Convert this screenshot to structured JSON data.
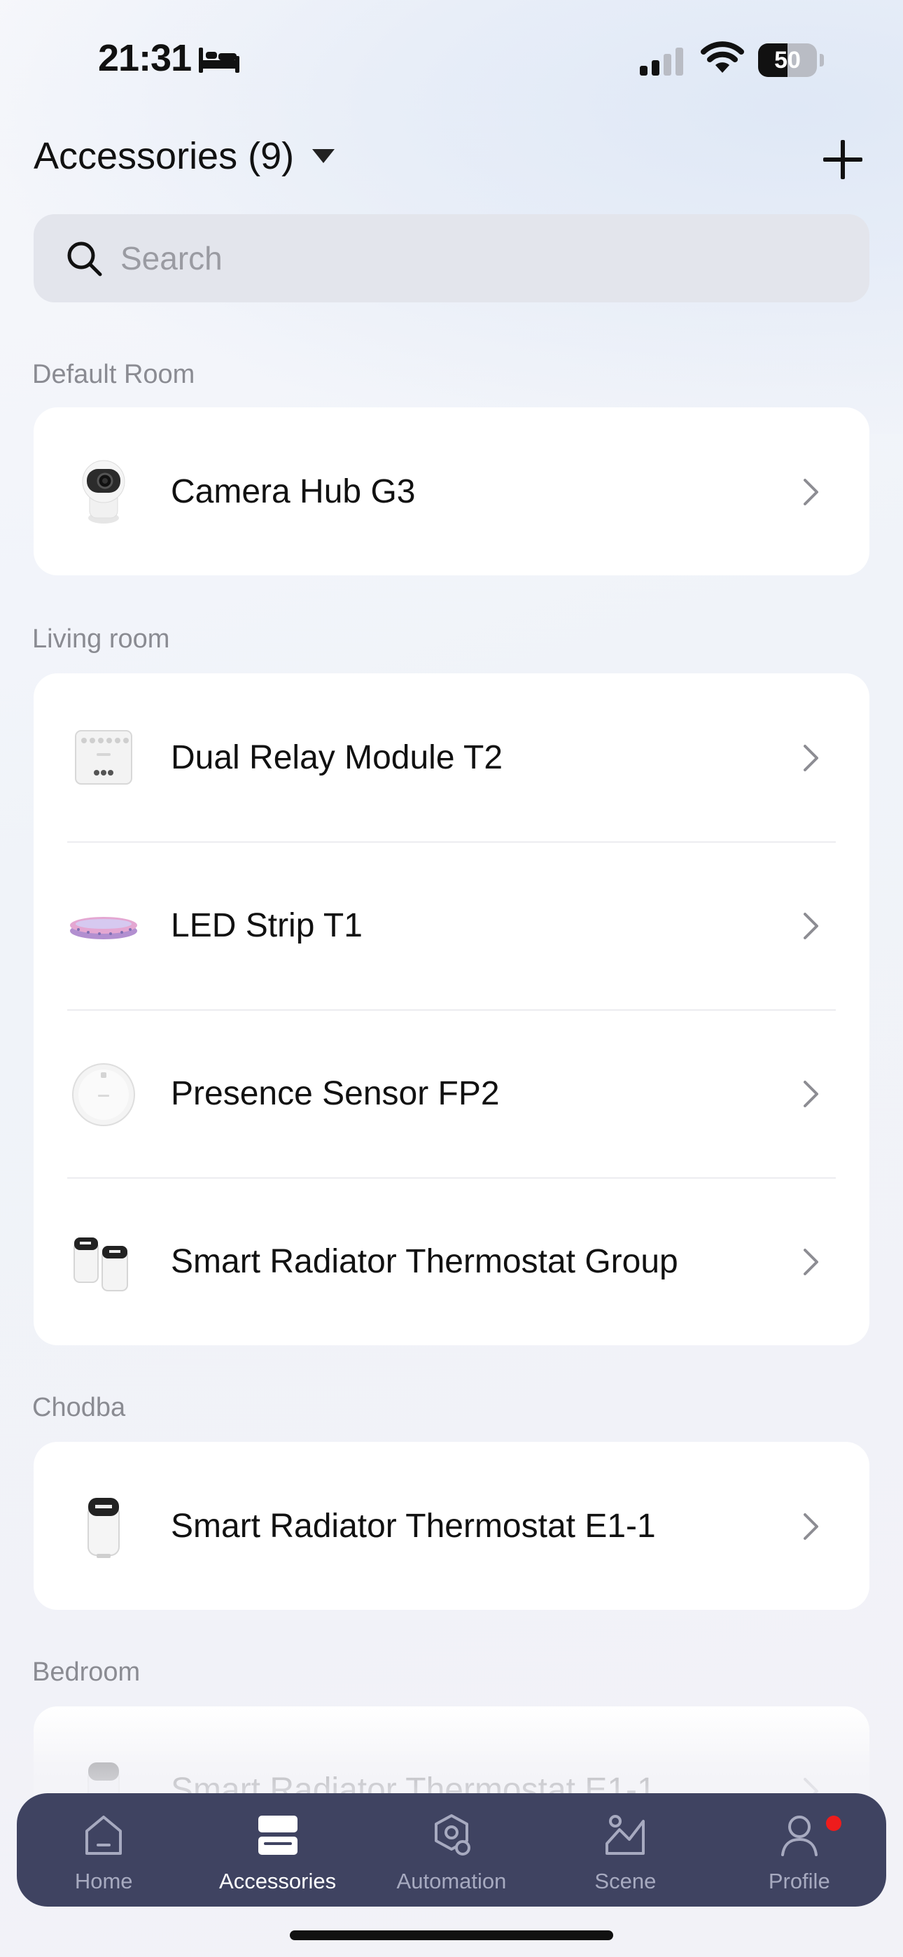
{
  "status_bar": {
    "time": "21:31",
    "focus_icon": "bed-icon",
    "battery_percent": 50,
    "battery_text": "50"
  },
  "header": {
    "title": "Accessories (9)",
    "add_icon": "plus-icon"
  },
  "search": {
    "placeholder": "Search"
  },
  "rooms": [
    {
      "name": "Default Room",
      "items": [
        {
          "label": "Camera Hub G3",
          "icon": "camera-hub-icon"
        }
      ]
    },
    {
      "name": "Living room",
      "items": [
        {
          "label": "Dual Relay Module T2",
          "icon": "relay-module-icon"
        },
        {
          "label": "LED Strip T1",
          "icon": "led-strip-icon"
        },
        {
          "label": "Presence Sensor FP2",
          "icon": "presence-sensor-icon"
        },
        {
          "label": "Smart Radiator Thermostat Group",
          "icon": "thermostat-group-icon"
        }
      ]
    },
    {
      "name": "Chodba",
      "items": [
        {
          "label": "Smart Radiator Thermostat E1-1",
          "icon": "thermostat-icon"
        }
      ]
    },
    {
      "name": "Bedroom",
      "items": [
        {
          "label": "Smart Radiator Thermostat E1-1",
          "icon": "thermostat-icon"
        }
      ]
    }
  ],
  "tab_bar": {
    "tabs": [
      {
        "label": "Home",
        "icon": "home-icon",
        "active": false
      },
      {
        "label": "Accessories",
        "icon": "accessories-icon",
        "active": true
      },
      {
        "label": "Automation",
        "icon": "automation-icon",
        "active": false
      },
      {
        "label": "Scene",
        "icon": "scene-icon",
        "active": false
      },
      {
        "label": "Profile",
        "icon": "profile-icon",
        "active": false,
        "badge": true
      }
    ]
  },
  "colors": {
    "tab_bar_bg": "#3f4361",
    "badge": "#ee1c1c",
    "section_label": "#8a8b92"
  }
}
